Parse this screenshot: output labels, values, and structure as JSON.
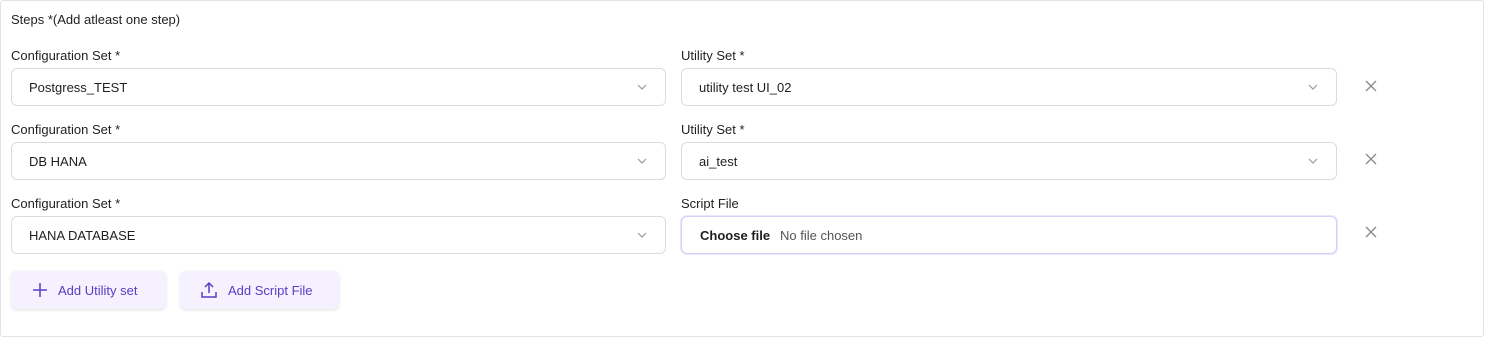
{
  "section_title": "Steps *(Add atleast one step)",
  "rows": [
    {
      "left_label": "Configuration Set *",
      "left_value": "Postgress_TEST",
      "right_label": "Utility Set *",
      "right_value": "utility test UI_02"
    },
    {
      "left_label": "Configuration Set *",
      "left_value": "DB HANA",
      "right_label": "Utility Set *",
      "right_value": "ai_test"
    },
    {
      "left_label": "Configuration Set *",
      "left_value": "HANA DATABASE",
      "right_label": "Script File",
      "file_button": "Choose file",
      "file_status": "No file chosen"
    }
  ],
  "actions": {
    "add_utility": "Add Utility set",
    "add_script": "Add Script File"
  },
  "icons": {
    "dropdown": "chevron-down-icon",
    "remove": "close-icon",
    "add": "plus-icon",
    "upload": "upload-icon"
  },
  "colors": {
    "accent": "#5b3cc4",
    "action_bg": "#f5f1fe",
    "border": "#dcdcdc",
    "file_focus_border": "#d9cdf6"
  }
}
